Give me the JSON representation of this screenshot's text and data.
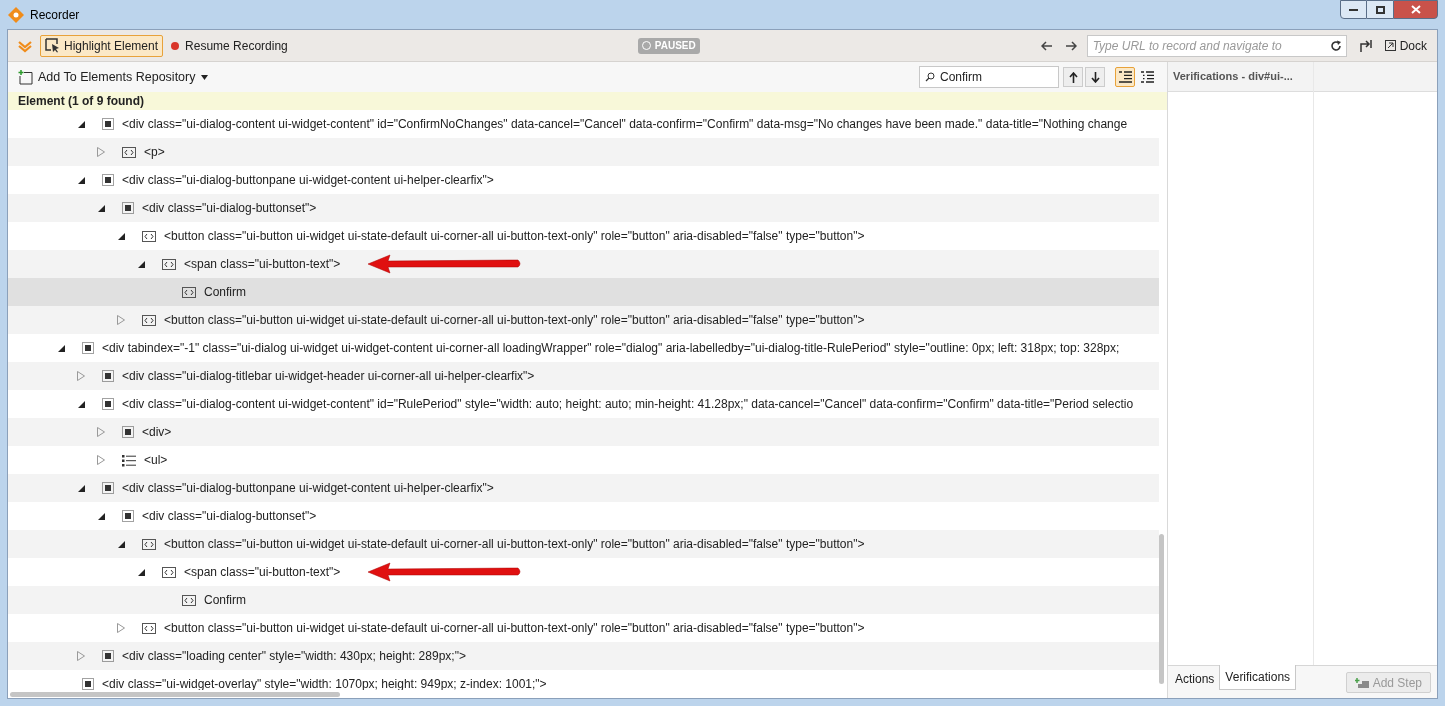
{
  "window": {
    "title": "Recorder"
  },
  "toolbar": {
    "highlight_button": {
      "label": "Highlight Element",
      "selected": true
    },
    "resume_button": "Resume Recording",
    "status_badge": "PAUSED",
    "url_field": {
      "placeholder": "Type URL to record and navigate to"
    },
    "dock_button": "Dock"
  },
  "elements_panel": {
    "add_button": "Add To Elements Repository",
    "search_field": {
      "value": "Confirm"
    },
    "view_toggles": [
      {
        "kind": "tree",
        "selected": true
      },
      {
        "kind": "list",
        "selected": false
      }
    ],
    "header": "Element (1 of 9 found)",
    "tree": [
      {
        "children": [
          {
            "label": "<div class=\"ui-dialog-content ui-widget-content\" id=\"ConfirmNoChanges\" data-cancel=\"Cancel\" data-confirm=\"Confirm\" data-msg=\"No changes have been made.\" data-title=\"Nothing change",
            "kind": "element",
            "expanded": true,
            "selected": false,
            "marked": false,
            "children": [
              {
                "label": "<p>",
                "kind": "text",
                "expanded": false,
                "selected": false,
                "marked": false
              }
            ]
          },
          {
            "label": "<div class=\"ui-dialog-buttonpane ui-widget-content ui-helper-clearfix\">",
            "kind": "element",
            "expanded": true,
            "selected": false,
            "marked": false,
            "children": [
              {
                "label": "<div class=\"ui-dialog-buttonset\">",
                "kind": "element",
                "expanded": true,
                "selected": false,
                "marked": false,
                "children": [
                  {
                    "label": "<button class=\"ui-button ui-widget ui-state-default ui-corner-all ui-button-text-only\" role=\"button\" aria-disabled=\"false\" type=\"button\">",
                    "kind": "text",
                    "expanded": true,
                    "selected": false,
                    "marked": false,
                    "children": [
                      {
                        "label": "<span class=\"ui-button-text\">",
                        "kind": "text",
                        "expanded": true,
                        "selected": false,
                        "marked": true,
                        "children": [
                          {
                            "label": "Confirm",
                            "kind": "text",
                            "selected": true,
                            "marked": false
                          }
                        ]
                      }
                    ]
                  },
                  {
                    "label": "<button class=\"ui-button ui-widget ui-state-default ui-corner-all ui-button-text-only\" role=\"button\" aria-disabled=\"false\" type=\"button\">",
                    "kind": "text",
                    "expanded": false,
                    "selected": false,
                    "marked": false
                  }
                ]
              }
            ]
          }
        ]
      },
      {
        "label": "<div tabindex=\"-1\" class=\"ui-dialog ui-widget ui-widget-content ui-corner-all loadingWrapper\" role=\"dialog\" aria-labelledby=\"ui-dialog-title-RulePeriod\" style=\"outline: 0px; left: 318px; top: 328px;",
        "kind": "element",
        "expanded": true,
        "selected": false,
        "marked": false,
        "children": [
          {
            "label": "<div class=\"ui-dialog-titlebar ui-widget-header ui-corner-all ui-helper-clearfix\">",
            "kind": "element",
            "expanded": false,
            "selected": false,
            "marked": false
          },
          {
            "label": "<div class=\"ui-dialog-content ui-widget-content\" id=\"RulePeriod\" style=\"width: auto; height: auto; min-height: 41.28px;\" data-cancel=\"Cancel\" data-confirm=\"Confirm\" data-title=\"Period selectio",
            "kind": "element",
            "expanded": true,
            "selected": false,
            "marked": false,
            "children": [
              {
                "label": "<div>",
                "kind": "element",
                "expanded": false,
                "selected": false,
                "marked": false
              },
              {
                "label": "<ul>",
                "kind": "list",
                "expanded": false,
                "selected": false,
                "marked": false
              }
            ]
          },
          {
            "label": "<div class=\"ui-dialog-buttonpane ui-widget-content ui-helper-clearfix\">",
            "kind": "element",
            "expanded": true,
            "selected": false,
            "marked": false,
            "children": [
              {
                "label": "<div class=\"ui-dialog-buttonset\">",
                "kind": "element",
                "expanded": true,
                "selected": false,
                "marked": false,
                "children": [
                  {
                    "label": "<button class=\"ui-button ui-widget ui-state-default ui-corner-all ui-button-text-only\" role=\"button\" aria-disabled=\"false\" type=\"button\">",
                    "kind": "text",
                    "expanded": true,
                    "selected": false,
                    "marked": false,
                    "children": [
                      {
                        "label": "<span class=\"ui-button-text\">",
                        "kind": "text",
                        "expanded": true,
                        "selected": false,
                        "marked": true,
                        "children": [
                          {
                            "label": "Confirm",
                            "kind": "text",
                            "selected": false,
                            "marked": false
                          }
                        ]
                      }
                    ]
                  },
                  {
                    "label": "<button class=\"ui-button ui-widget ui-state-default ui-corner-all ui-button-text-only\" role=\"button\" aria-disabled=\"false\" type=\"button\">",
                    "kind": "text",
                    "expanded": false,
                    "selected": false,
                    "marked": false
                  }
                ]
              }
            ]
          },
          {
            "label": "<div class=\"loading center\" style=\"width: 430px; height: 289px;\">",
            "kind": "element",
            "expanded": false,
            "selected": false,
            "marked": false
          }
        ]
      },
      {
        "label": "<div class=\"ui-widget-overlay\" style=\"width: 1070px; height: 949px; z-index: 1001;\">",
        "kind": "element",
        "selected": false,
        "marked": false
      }
    ]
  },
  "side_panel": {
    "header": "Verifications - div#ui-...",
    "tabs": [
      {
        "label": "Actions",
        "selected": false
      },
      {
        "label": "Verifications",
        "selected": true
      }
    ],
    "add_step_button": {
      "label": "Add Step",
      "disabled": true
    }
  }
}
